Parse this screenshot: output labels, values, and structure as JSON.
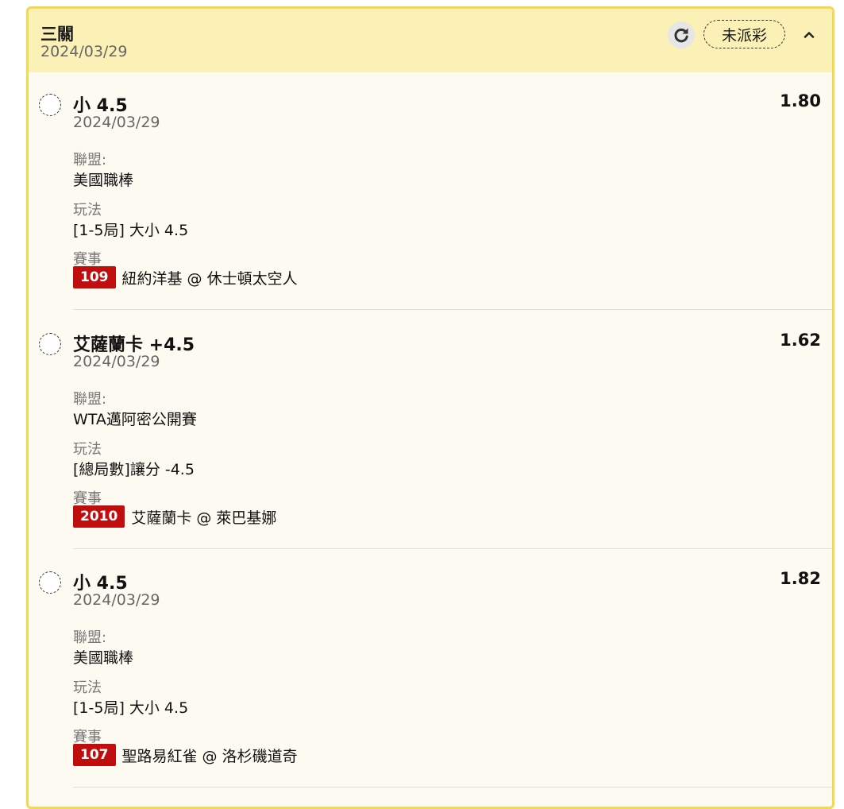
{
  "header": {
    "title": "三關",
    "date": "2024/03/29",
    "status": "未派彩",
    "icons": {
      "refresh": "refresh-icon",
      "collapse": "chevron-up-icon"
    }
  },
  "labels": {
    "league": "聯盟:",
    "market": "玩法",
    "event": "賽事"
  },
  "bets": [
    {
      "pick": "小 4.5",
      "odds": "1.80",
      "date": "2024/03/29",
      "league": "美國職棒",
      "market": "[1-5局] 大小 4.5",
      "event_no": "109",
      "event_name": "紐約洋基 @ 休士頓太空人"
    },
    {
      "pick": "艾薩蘭卡 +4.5",
      "odds": "1.62",
      "date": "2024/03/29",
      "league": "WTA邁阿密公開賽",
      "market": "[總局數]讓分 -4.5",
      "event_no": "2010",
      "event_name": "艾薩蘭卡 @ 萊巴基娜"
    },
    {
      "pick": "小 4.5",
      "odds": "1.82",
      "date": "2024/03/29",
      "league": "美國職棒",
      "market": "[1-5局] 大小 4.5",
      "event_no": "107",
      "event_name": "聖路易紅雀 @ 洛杉磯道奇"
    }
  ],
  "colors": {
    "card_border": "#f3d94e",
    "header_bg": "#fbf0b5",
    "body_bg": "#fdfbf1",
    "event_badge": "#c00d0d"
  }
}
